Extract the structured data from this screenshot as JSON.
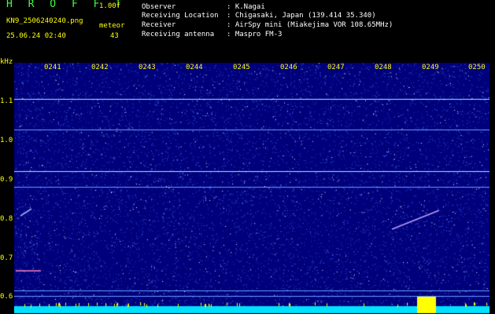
{
  "header": {
    "title": "H R O F F T",
    "version": "1.00f",
    "filename": "KN9_2506240240.png",
    "datetime": "25.06.24 02:40",
    "meteor_label": "meteor",
    "meteor_count": "43",
    "fields": [
      {
        "key": "Observer",
        "value": ": K.Nagai"
      },
      {
        "key": "Receiving Location",
        "value": ": Chigasaki, Japan (139.414 35.340)"
      },
      {
        "key": "Receiver",
        "value": ": AirSpy mini (Miakejima VOR 108.65MHz)"
      },
      {
        "key": "Receiving antenna",
        "value": ": Maspro FM-3"
      }
    ]
  },
  "axis": {
    "unit": "kHz",
    "y_labels": [
      "1.1",
      "1.0",
      "0.9",
      "0.8",
      "0.7",
      "0.6"
    ],
    "x_labels": [
      "0241",
      "0242",
      "0243",
      "0244",
      "0245",
      "0246",
      "0247",
      "0248",
      "0249",
      "0250"
    ]
  },
  "colors": {
    "background": "#000000",
    "plot_bg": "#00007a",
    "label": "#ffff00",
    "title": "#40ff40",
    "signal_line": "#a0e0ff"
  }
}
